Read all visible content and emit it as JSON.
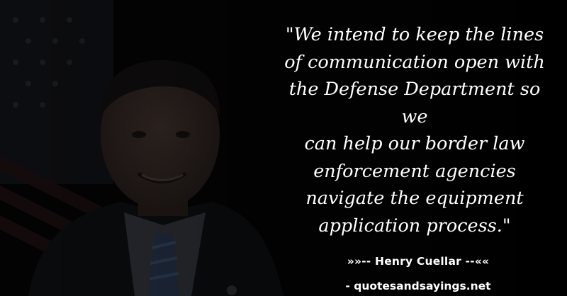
{
  "quote": {
    "lines": [
      "\"We intend to keep the lines",
      "of communication open with",
      "the Defense Department so we",
      "can help our border law",
      "enforcement agencies",
      "navigate the equipment",
      "application process.\""
    ]
  },
  "author": {
    "text": "»»-- Henry Cuellar --««"
  },
  "site": {
    "text": "- quotesandsayings.net"
  },
  "colors": {
    "background": "#050505",
    "text": "#ffffff"
  },
  "icons": {
    "portrait": "portrait-photo"
  }
}
